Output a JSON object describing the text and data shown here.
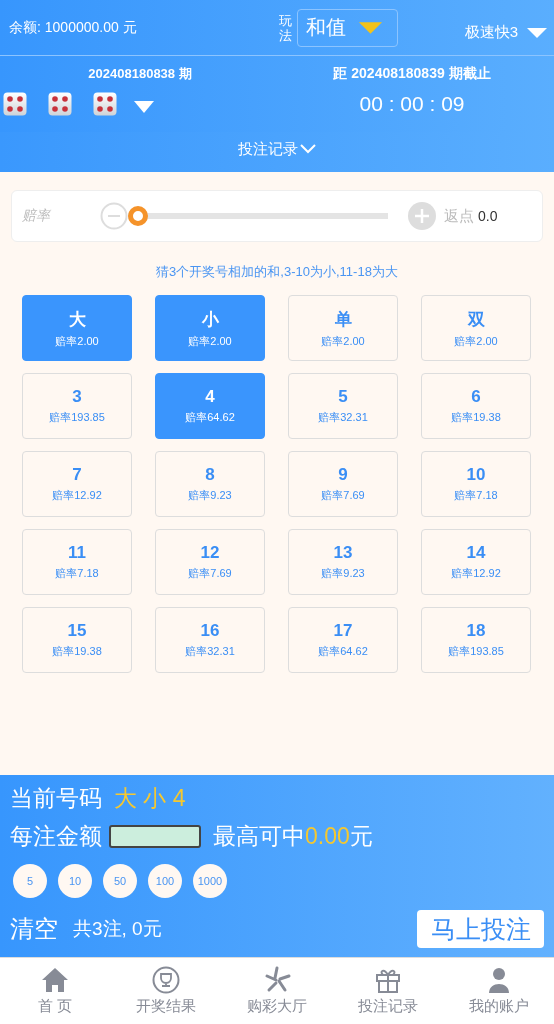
{
  "header": {
    "balance": "余额: 1000000.00 元",
    "play_label": "玩法",
    "play_value": "和值",
    "lottery": "极速快3"
  },
  "draw": {
    "period": "202408180838 期",
    "deadline": "距 202408180839 期截止",
    "countdown": "00 : 00 : 09",
    "records_link": "投注记录"
  },
  "odds_slider": {
    "label": "赔率",
    "level": 0,
    "rebate_label": "返点",
    "rebate_value": "0.0"
  },
  "hint": "猜3个开奖号相加的和,3-10为小,11-18为大",
  "options": [
    {
      "name": "大",
      "odds": "赔率2.00",
      "selected": true
    },
    {
      "name": "小",
      "odds": "赔率2.00",
      "selected": true
    },
    {
      "name": "单",
      "odds": "赔率2.00",
      "selected": false
    },
    {
      "name": "双",
      "odds": "赔率2.00",
      "selected": false
    },
    {
      "name": "3",
      "odds": "赔率193.85",
      "selected": false
    },
    {
      "name": "4",
      "odds": "赔率64.62",
      "selected": true
    },
    {
      "name": "5",
      "odds": "赔率32.31",
      "selected": false
    },
    {
      "name": "6",
      "odds": "赔率19.38",
      "selected": false
    },
    {
      "name": "7",
      "odds": "赔率12.92",
      "selected": false
    },
    {
      "name": "8",
      "odds": "赔率9.23",
      "selected": false
    },
    {
      "name": "9",
      "odds": "赔率7.69",
      "selected": false
    },
    {
      "name": "10",
      "odds": "赔率7.18",
      "selected": false
    },
    {
      "name": "11",
      "odds": "赔率7.18",
      "selected": false
    },
    {
      "name": "12",
      "odds": "赔率7.69",
      "selected": false
    },
    {
      "name": "13",
      "odds": "赔率9.23",
      "selected": false
    },
    {
      "name": "14",
      "odds": "赔率12.92",
      "selected": false
    },
    {
      "name": "15",
      "odds": "赔率19.38",
      "selected": false
    },
    {
      "name": "16",
      "odds": "赔率32.31",
      "selected": false
    },
    {
      "name": "17",
      "odds": "赔率64.62",
      "selected": false
    },
    {
      "name": "18",
      "odds": "赔率193.85",
      "selected": false
    }
  ],
  "bet_panel": {
    "current_label": "当前号码",
    "current_value": "大 小 4",
    "amount_label": "每注金额",
    "max_win_label": "最高可中",
    "max_win_value": "0.00",
    "max_win_unit": "元",
    "chips": [
      "5",
      "10",
      "50",
      "100",
      "1000"
    ],
    "clear": "清空",
    "summary": "共3注, 0元",
    "submit": "马上投注"
  },
  "nav": [
    {
      "kind": "home",
      "label": "首 页"
    },
    {
      "kind": "trophy",
      "label": "开奖结果"
    },
    {
      "kind": "star",
      "label": "购彩大厅"
    },
    {
      "kind": "gift",
      "label": "投注记录"
    },
    {
      "kind": "user",
      "label": "我的账户"
    }
  ]
}
